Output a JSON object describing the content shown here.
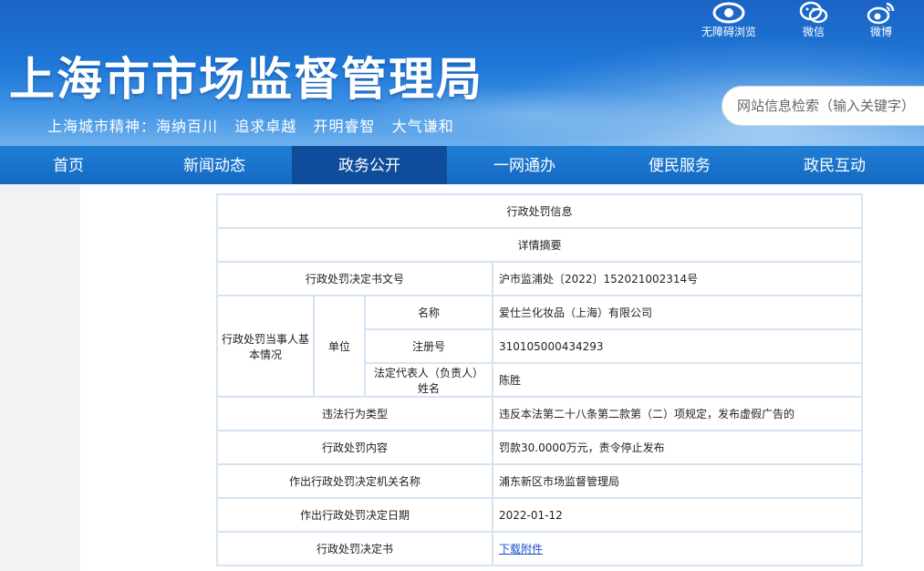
{
  "header": {
    "title": "上海市市场监督管理局",
    "motto": "上海城市精神：海纳百川   追求卓越   开明睿智   大气谦和",
    "tools": [
      {
        "label": "无障碍浏览",
        "icon": "eye-icon"
      },
      {
        "label": "微信",
        "icon": "wechat-icon"
      },
      {
        "label": "微博",
        "icon": "weibo-icon"
      }
    ],
    "search_placeholder": "网站信息检索（输入关键字）"
  },
  "nav": {
    "items": [
      "首页",
      "新闻动态",
      "政务公开",
      "一网通办",
      "便民服务",
      "政民互动"
    ],
    "active_index": 2
  },
  "colors": {
    "header_blue": "#1f78d8",
    "nav_blue": "#1669c2",
    "nav_active": "#0f4d9c",
    "table_border": "#d5e4f3",
    "link": "#1a4fc9"
  },
  "table": {
    "title": "行政处罚信息",
    "subtitle": "详情摘要",
    "doc_no_label": "行政处罚决定书文号",
    "doc_no_value": "沪市监浦处〔2022〕152021002314号",
    "party_label": "行政处罚当事人基本情况",
    "unit_label": "单位",
    "name_label": "名称",
    "name_value": "爱仕兰化妆品（上海）有限公司",
    "reg_label": "注册号",
    "reg_value": "310105000434293",
    "rep_label": "法定代表人（负责人）姓名",
    "rep_value": "陈胜",
    "violation_label": "违法行为类型",
    "violation_value": "违反本法第二十八条第二款第（二）项规定，发布虚假广告的",
    "penalty_label": "行政处罚内容",
    "penalty_value": "罚款30.0000万元，责令停止发布",
    "authority_label": "作出行政处罚决定机关名称",
    "authority_value": "浦东新区市场监督管理局",
    "date_label": "作出行政处罚决定日期",
    "date_value": "2022-01-12",
    "decision_label": "行政处罚决定书",
    "decision_link": "下载附件"
  }
}
